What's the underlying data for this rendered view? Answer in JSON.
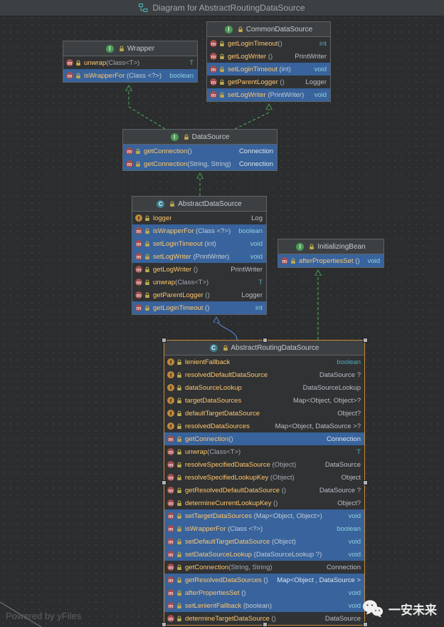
{
  "title_bar": {
    "title": "Diagram for AbstractRoutingDataSource"
  },
  "footer": {
    "powered_by": "Powered by yFiles",
    "brand": "一安未来"
  },
  "colors": {
    "background": "#2b2d2e",
    "highlight_row": "#38639c",
    "interface_edge": "#4d9e57",
    "extends_edge": "#5584c9",
    "selection_border": "#c98a3c",
    "member_name": "#ffc66d"
  },
  "classes": [
    {
      "id": "wrapper",
      "kind": "interface",
      "name": "Wrapper",
      "selected": false,
      "members": [
        {
          "kind": "method",
          "name": "unwrap",
          "params": "(Class<T>)",
          "type": "T",
          "prim": true,
          "hl": false
        },
        {
          "kind": "method",
          "name": "isWrapperFor",
          "params": " (Class <?>)",
          "type": "boolean",
          "prim": true,
          "hl": true
        }
      ]
    },
    {
      "id": "common-data-source",
      "kind": "interface",
      "name": "CommonDataSource",
      "selected": false,
      "members": [
        {
          "kind": "method",
          "name": "getLoginTimeout",
          "params": "()",
          "type": "int",
          "prim": true,
          "hl": false
        },
        {
          "kind": "method",
          "name": "getLogWriter",
          "params": " ()",
          "type": "PrintWriter",
          "prim": false,
          "hl": false
        },
        {
          "kind": "method",
          "name": "setLoginTimeout",
          "params": " (int)",
          "type": "void",
          "prim": true,
          "hl": true
        },
        {
          "kind": "method",
          "name": "getParentLogger",
          "params": " ()",
          "type": "Logger",
          "prim": false,
          "hl": false
        },
        {
          "kind": "method",
          "name": "setLogWriter",
          "params": " (PrintWriter)",
          "type": "void",
          "prim": true,
          "hl": true
        }
      ]
    },
    {
      "id": "data-source",
      "kind": "interface",
      "name": "DataSource",
      "selected": false,
      "members": [
        {
          "kind": "method",
          "name": "getConnection",
          "params": "()",
          "type": "Connection",
          "prim": false,
          "hl": true
        },
        {
          "kind": "method",
          "name": "getConnection",
          "params": "(String, String)",
          "type": "Connection",
          "prim": false,
          "hl": true
        }
      ]
    },
    {
      "id": "abstract-data-source",
      "kind": "class",
      "name": "AbstractDataSource",
      "selected": false,
      "members": [
        {
          "kind": "field",
          "name": "logger",
          "params": "",
          "type": "Log",
          "prim": false,
          "hl": false
        },
        {
          "kind": "method",
          "name": "isWrapperFor",
          "params": " (Class <?>)",
          "type": "boolean",
          "prim": true,
          "hl": true
        },
        {
          "kind": "method",
          "name": "setLoginTimeout",
          "params": " (int)",
          "type": "void",
          "prim": true,
          "hl": true
        },
        {
          "kind": "method",
          "name": "setLogWriter",
          "params": " (PrintWriter)",
          "type": "void",
          "prim": true,
          "hl": true
        },
        {
          "kind": "method",
          "name": "getLogWriter",
          "params": " ()",
          "type": "PrintWriter",
          "prim": false,
          "hl": false
        },
        {
          "kind": "method",
          "name": "unwrap",
          "params": "(Class<T>)",
          "type": "T",
          "prim": true,
          "hl": false
        },
        {
          "kind": "method",
          "name": "getParentLogger",
          "params": " ()",
          "type": "Logger",
          "prim": false,
          "hl": false
        },
        {
          "kind": "method",
          "name": "getLoginTimeout",
          "params": " ()",
          "type": "int",
          "prim": true,
          "hl": true
        }
      ]
    },
    {
      "id": "initializing-bean",
      "kind": "interface",
      "name": "InitializingBean",
      "selected": false,
      "members": [
        {
          "kind": "method",
          "name": "afterPropertiesSet",
          "params": " ()",
          "type": "void",
          "prim": true,
          "hl": true
        }
      ]
    },
    {
      "id": "abstract-routing-data-source",
      "kind": "class",
      "name": "AbstractRoutingDataSource",
      "selected": true,
      "members": [
        {
          "kind": "field",
          "name": "lenientFallback",
          "params": "",
          "type": "boolean",
          "prim": true,
          "hl": false
        },
        {
          "kind": "field",
          "name": "resolvedDefaultDataSource",
          "params": "",
          "type": "DataSource ?",
          "prim": false,
          "hl": false
        },
        {
          "kind": "field",
          "name": "dataSourceLookup",
          "params": "",
          "type": "DataSourceLookup",
          "prim": false,
          "hl": false
        },
        {
          "kind": "field",
          "name": "targetDataSources",
          "params": "",
          "type": "Map<Object, Object>?",
          "prim": false,
          "hl": false
        },
        {
          "kind": "field",
          "name": "defaultTargetDataSource",
          "params": "",
          "type": "Object?",
          "prim": false,
          "hl": false
        },
        {
          "kind": "field",
          "name": "resolvedDataSources",
          "params": "",
          "type": "Map<Object, DataSource >?",
          "prim": false,
          "hl": false
        },
        {
          "kind": "method",
          "name": "getConnection",
          "params": "()",
          "type": "Connection",
          "prim": false,
          "hl": true
        },
        {
          "kind": "method",
          "name": "unwrap",
          "params": "(Class<T>)",
          "type": "T",
          "prim": true,
          "hl": false
        },
        {
          "kind": "method",
          "name": "resolveSpecifiedDataSource",
          "params": " (Object)",
          "type": "DataSource",
          "prim": false,
          "hl": false
        },
        {
          "kind": "method",
          "name": "resolveSpecifiedLookupKey",
          "params": " (Object)",
          "type": "Object",
          "prim": false,
          "hl": false
        },
        {
          "kind": "method",
          "name": "getResolvedDefaultDataSource",
          "params": " ()",
          "type": "DataSource ?",
          "prim": false,
          "hl": false
        },
        {
          "kind": "method",
          "name": "determineCurrentLookupKey",
          "params": " ()",
          "type": "Object?",
          "prim": false,
          "hl": false
        },
        {
          "kind": "method",
          "name": "setTargetDataSources",
          "params": " (Map<Object, Object>)",
          "type": "void",
          "prim": true,
          "hl": true
        },
        {
          "kind": "method",
          "name": "isWrapperFor",
          "params": " (Class <?>)",
          "type": "boolean",
          "prim": true,
          "hl": true
        },
        {
          "kind": "method",
          "name": "setDefaultTargetDataSource",
          "params": " (Object)",
          "type": "void",
          "prim": true,
          "hl": true
        },
        {
          "kind": "method",
          "name": "setDataSourceLookup",
          "params": " (DataSourceLookup ?)",
          "type": "void",
          "prim": true,
          "hl": true
        },
        {
          "kind": "method",
          "name": "getConnection",
          "params": "(String, String)",
          "type": "Connection",
          "prim": false,
          "hl": false
        },
        {
          "kind": "method",
          "name": "getResolvedDataSources",
          "params": " ()",
          "type": "Map<Object , DataSource >",
          "prim": false,
          "hl": true
        },
        {
          "kind": "method",
          "name": "afterPropertiesSet",
          "params": " ()",
          "type": "void",
          "prim": true,
          "hl": true
        },
        {
          "kind": "method",
          "name": "setLenientFallback",
          "params": " (boolean)",
          "type": "void",
          "prim": true,
          "hl": true
        },
        {
          "kind": "method",
          "name": "determineTargetDataSource",
          "params": " ()",
          "type": "DataSource",
          "prim": false,
          "hl": false
        }
      ]
    }
  ]
}
